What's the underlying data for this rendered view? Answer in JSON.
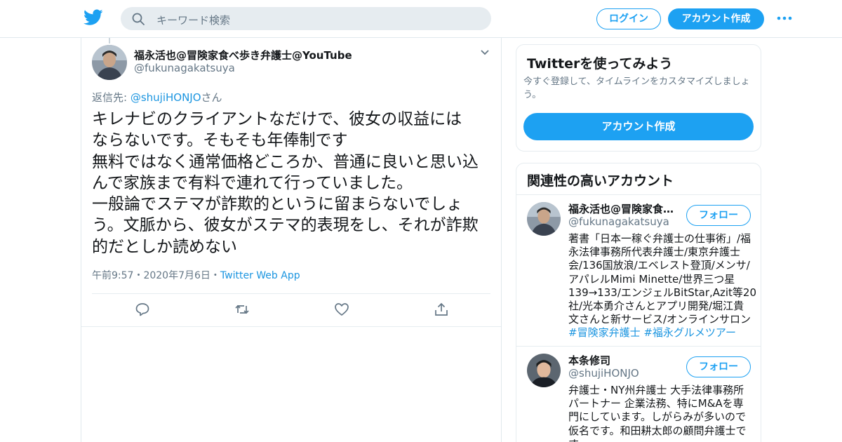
{
  "brand": {
    "color": "#1da1f2",
    "logo_icon": "twitter-bird-icon"
  },
  "header": {
    "search_placeholder": "キーワード検索",
    "login_label": "ログイン",
    "signup_label": "アカウント作成",
    "more_icon": "more-dots-icon"
  },
  "tweet": {
    "author_name": "福永活也@冒険家食べ歩き弁護士@YouTube",
    "author_handle": "@fukunagakatsuya",
    "reply_prefix": "返信先: ",
    "reply_mention": "@shujiHONJO",
    "reply_suffix": "さん",
    "text_lines": [
      "キレナビのクライアントなだけで、彼女の収益には",
      "ならないです。そもそも年俸制です",
      "無料ではなく通常価格どころか、普通に良いと思い込",
      "んで家族まで有料で連れて行っていました。",
      "一般論でステマが詐欺的というに留まらないでしょ",
      "う。文脈から、彼女がステマ的表現をし、それが詐欺",
      "的だとしか読めない"
    ],
    "time": "午前9:57",
    "date": "2020年7月6日",
    "separator": "・",
    "source": "Twitter Web App",
    "actions": [
      "reply-icon",
      "retweet-icon",
      "like-icon",
      "share-icon"
    ]
  },
  "sidebar": {
    "signup_card": {
      "title": "Twitterを使ってみよう",
      "description": "今すぐ登録して、タイムラインをカスタマイズしましょう。",
      "cta_label": "アカウント作成"
    },
    "related": {
      "title": "関連性の高いアカウント",
      "accounts": [
        {
          "name": "福永活也@冒険家食べ歩き弁護士@YouTube",
          "handle": "@fukunagakatsuya",
          "follow_label": "フォロー",
          "bio_lines": [
            "著書「日本一稼ぐ弁護士の仕事術」/福",
            "永法律事務所代表弁護士/東京弁護士",
            "会/136国放浪/エベレスト登頂/メンサ/",
            "アパレルMimi Minette/世界三つ星",
            "139→133/エンジェルBitStar,Azit等20",
            "社/光本勇介さんとアプリ開発/堀江貴",
            "文さんと新サービス/オンラインサロン"
          ],
          "hashtags": [
            "#冒険家弁護士",
            "#福永グルメツアー"
          ]
        },
        {
          "name": "本条修司",
          "handle": "@shujiHONJO",
          "follow_label": "フォロー",
          "bio_lines": [
            "弁護士・NY州弁護士 大手法律事務所",
            "パートナー 企業法務、特にM&Aを専",
            "門にしています。しがらみが多いので",
            "仮名です。和田耕太郎の顧問弁護士で",
            "す"
          ]
        }
      ]
    }
  }
}
